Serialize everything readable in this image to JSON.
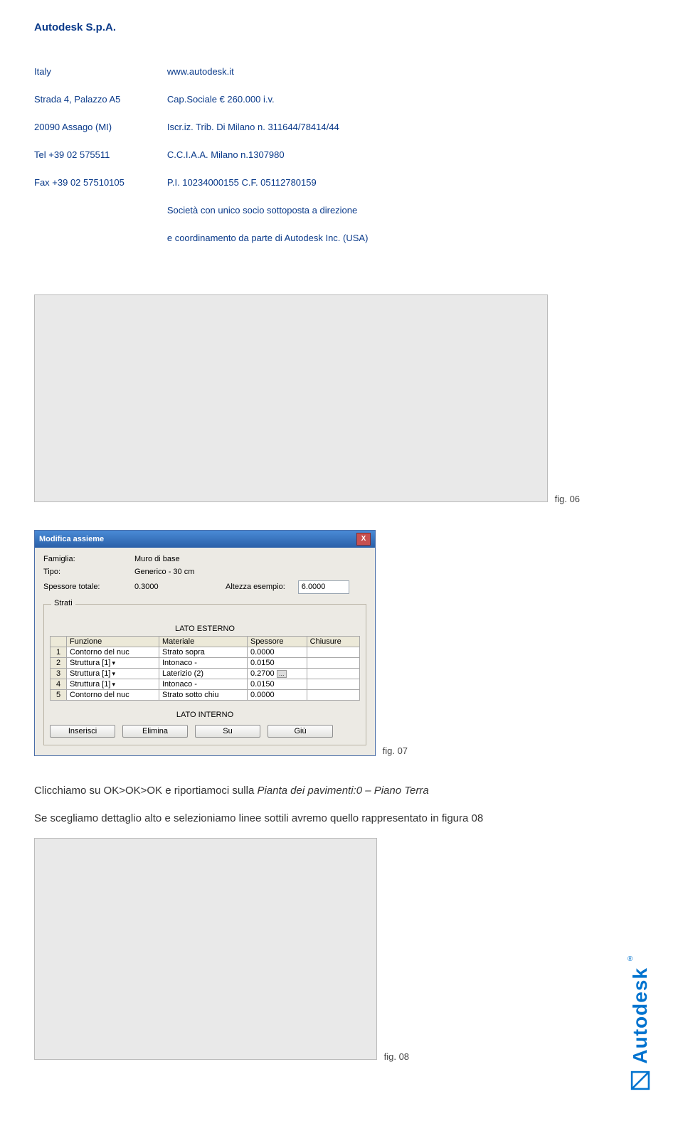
{
  "company": "Autodesk S.p.A.",
  "address": {
    "line1": "Italy",
    "line2": "Strada 4, Palazzo A5",
    "line3": "20090 Assago (MI)",
    "line4": "Tel   +39 02 575511",
    "line5": "Fax  +39 02 57510105"
  },
  "legal": {
    "line1": "www.autodesk.it",
    "line2": "Cap.Sociale € 260.000 i.v.",
    "line3": "Iscr.iz. Trib. Di Milano n. 311644/78414/44",
    "line4": "C.C.I.A.A. Milano n.1307980",
    "line5": "P.I. 10234000155  C.F. 05112780159",
    "line6": "Società con unico socio sottoposta a direzione",
    "line7": "e coordinamento da parte di Autodesk Inc. (USA)"
  },
  "fig06_label": "fig. 06",
  "modifica": {
    "title": "Modifica assieme",
    "famiglia_label": "Famiglia:",
    "famiglia_value": "Muro di base",
    "tipo_label": "Tipo:",
    "tipo_value": "Generico - 30 cm",
    "spessore_label": "Spessore totale:",
    "spessore_value": "0.3000",
    "altezza_label": "Altezza esempio:",
    "altezza_value": "6.0000",
    "group_label": "Strati",
    "lato_esterno": "LATO ESTERNO",
    "lato_interno": "LATO INTERNO",
    "headers": {
      "funzione": "Funzione",
      "materiale": "Materiale",
      "spessore": "Spessore",
      "chiusure": "Chiusure"
    },
    "rows": [
      {
        "n": "1",
        "funzione": "Contorno del nuc",
        "materiale": "Strato sopra",
        "spessore": "0.0000",
        "chiusure": ""
      },
      {
        "n": "2",
        "funzione": "Struttura [1]",
        "materiale": "Intonaco -",
        "spessore": "0.0150",
        "chiusure": ""
      },
      {
        "n": "3",
        "funzione": "Struttura [1]",
        "materiale": "Laterizio (2)",
        "spessore": "0.2700",
        "chiusure": ""
      },
      {
        "n": "4",
        "funzione": "Struttura [1]",
        "materiale": "Intonaco -",
        "spessore": "0.0150",
        "chiusure": ""
      },
      {
        "n": "5",
        "funzione": "Contorno del nuc",
        "materiale": "Strato sotto chiu",
        "spessore": "0.0000",
        "chiusure": ""
      }
    ],
    "btn_inserisci": "Inserisci",
    "btn_elimina": "Elimina",
    "btn_su": "Su",
    "btn_giu": "Giù"
  },
  "fig07_label": "fig. 07",
  "body_line1a": "Clicchiamo su OK>OK>OK e riportiamoci sulla ",
  "body_line1b": "Pianta dei pavimenti:0 – Piano Terra",
  "body_line2": "Se scegliamo dettaglio alto e selezioniamo linee sottili avremo quello rappresentato in figura 08",
  "fig08_label": "fig. 08",
  "logo_text": "Autodesk"
}
